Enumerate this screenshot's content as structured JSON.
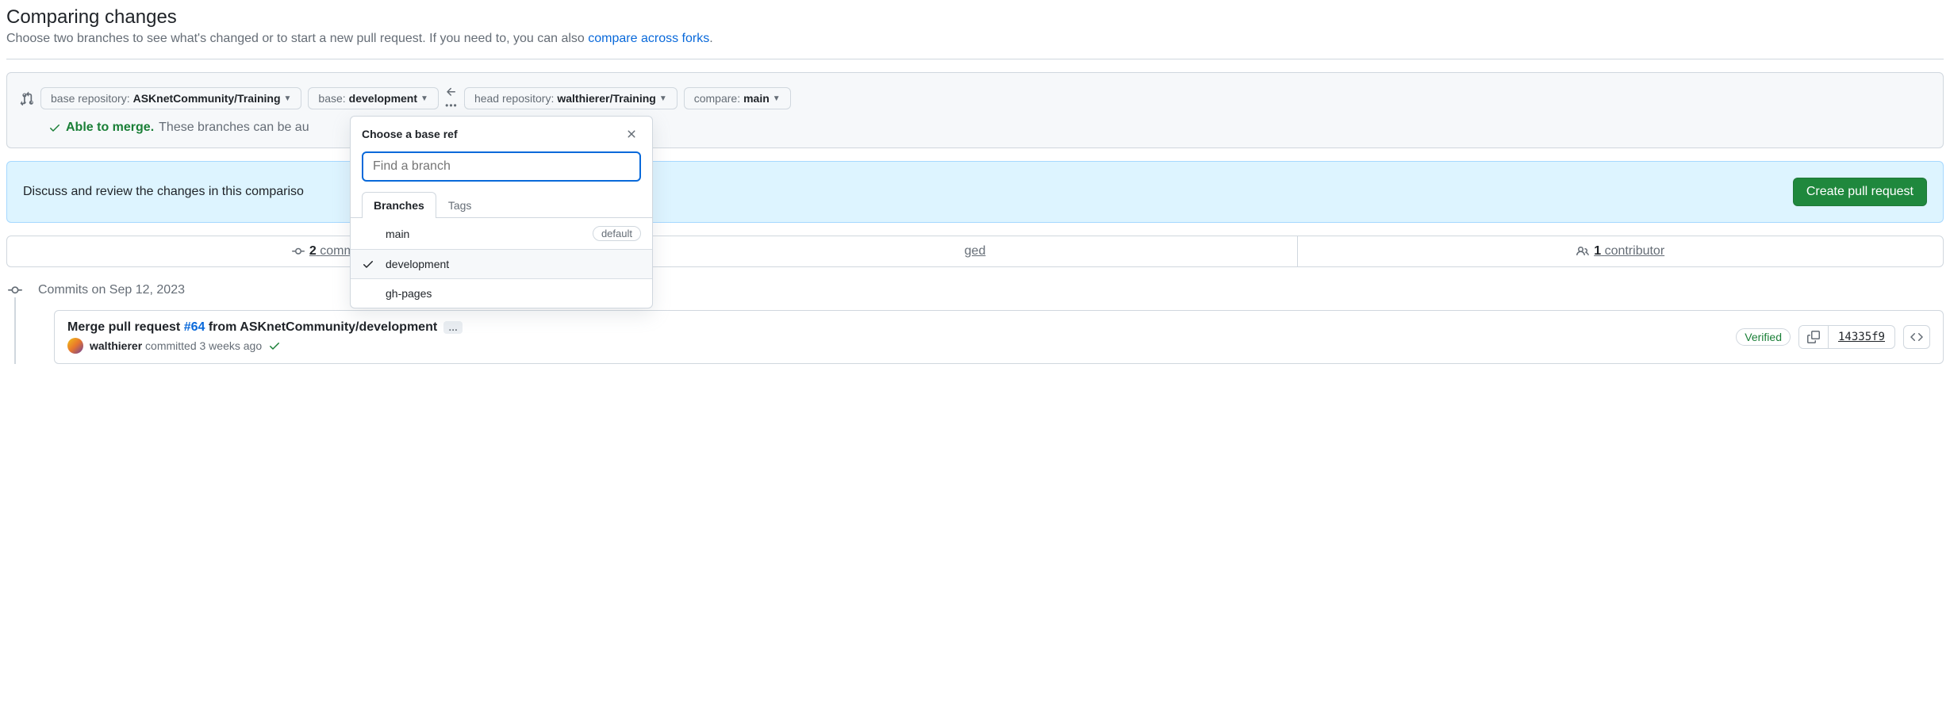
{
  "header": {
    "title": "Comparing changes",
    "subtitle_prefix": "Choose two branches to see what's changed or to start a new pull request. If you need to, you can also ",
    "subtitle_link": "compare across forks",
    "subtitle_suffix": "."
  },
  "compare": {
    "base_repo_label": "base repository: ",
    "base_repo_value": "ASKnetCommunity/Training",
    "base_ref_label": "base: ",
    "base_ref_value": "development",
    "head_repo_label": "head repository: ",
    "head_repo_value": "walthierer/Training",
    "compare_ref_label": "compare: ",
    "compare_ref_value": "main",
    "merge_ok_label": "Able to merge.",
    "merge_ok_rest": "These branches can be au"
  },
  "ref_dropdown": {
    "title": "Choose a base ref",
    "filter_placeholder": "Find a branch",
    "tabs": {
      "branches": "Branches",
      "tags": "Tags"
    },
    "items": [
      {
        "name": "main",
        "default": true,
        "selected": false
      },
      {
        "name": "development",
        "default": false,
        "selected": true
      },
      {
        "name": "gh-pages",
        "default": false,
        "selected": false
      }
    ],
    "default_badge": "default"
  },
  "discuss": {
    "text": "Discuss and review the changes in this compariso",
    "create_pr_label": "Create pull request"
  },
  "stats": {
    "commits_count": "2",
    "commits_label": "commits",
    "files_label": "ged",
    "contributors_count": "1",
    "contributors_label": "contributor"
  },
  "timeline": {
    "date_heading": "Commits on Sep 12, 2023",
    "commit": {
      "title_prefix": "Merge pull request ",
      "pr_link": "#64",
      "title_suffix": " from ASKnetCommunity/development",
      "author": "walthierer",
      "meta_rest": "committed 3 weeks ago",
      "verified": "Verified",
      "sha": "14335f9"
    }
  }
}
